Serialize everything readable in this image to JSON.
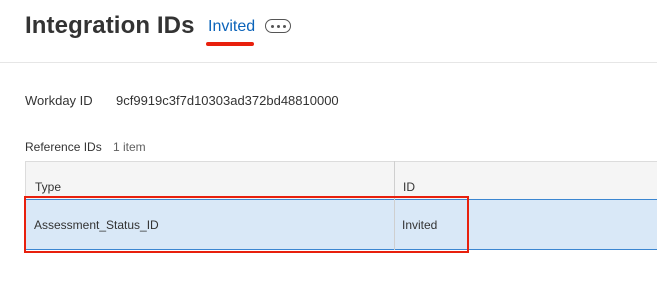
{
  "header": {
    "title": "Integration IDs",
    "tab_label": "Invited",
    "more_icon": "more-options-icon"
  },
  "workday": {
    "label": "Workday ID",
    "value": "9cf9919c3f7d10303ad372bd48810000"
  },
  "reference_ids": {
    "label": "Reference IDs",
    "count": "1 item",
    "columns": [
      "Type",
      "ID"
    ],
    "rows": [
      {
        "type": "Assessment_Status_ID",
        "id": "Invited"
      }
    ]
  },
  "colors": {
    "accent": "#0b63ba",
    "tab_underline": "#e8200d",
    "selected_row": "#d9e8f7",
    "annotation_box": "#e8200d"
  }
}
